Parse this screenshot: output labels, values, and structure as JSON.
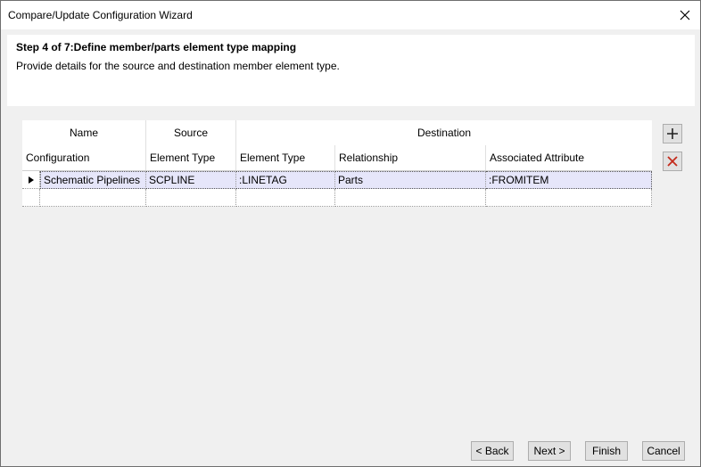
{
  "window": {
    "title": "Compare/Update Configuration Wizard"
  },
  "header": {
    "step_title": "Step 4 of 7:Define member/parts element type mapping",
    "step_description": "Provide details for the source and destination member element type."
  },
  "grid": {
    "group_headers": {
      "name": "Name",
      "source": "Source",
      "destination": "Destination"
    },
    "columns": [
      "Configuration",
      "Element Type",
      "Element Type",
      "Relationship",
      "Associated Attribute"
    ],
    "rows": [
      [
        "Schematic Pipelines",
        "SCPLINE",
        ":LINETAG",
        "Parts",
        ":FROMITEM"
      ],
      [
        "",
        "",
        "",
        "",
        ""
      ]
    ]
  },
  "side_buttons": {
    "add_icon": "plus-icon",
    "delete_icon": "delete-x-icon",
    "delete_color": "#c42b1c"
  },
  "footer": {
    "back_label": "< Back",
    "next_label": "Next >",
    "finish_label": "Finish",
    "cancel_label": "Cancel"
  }
}
